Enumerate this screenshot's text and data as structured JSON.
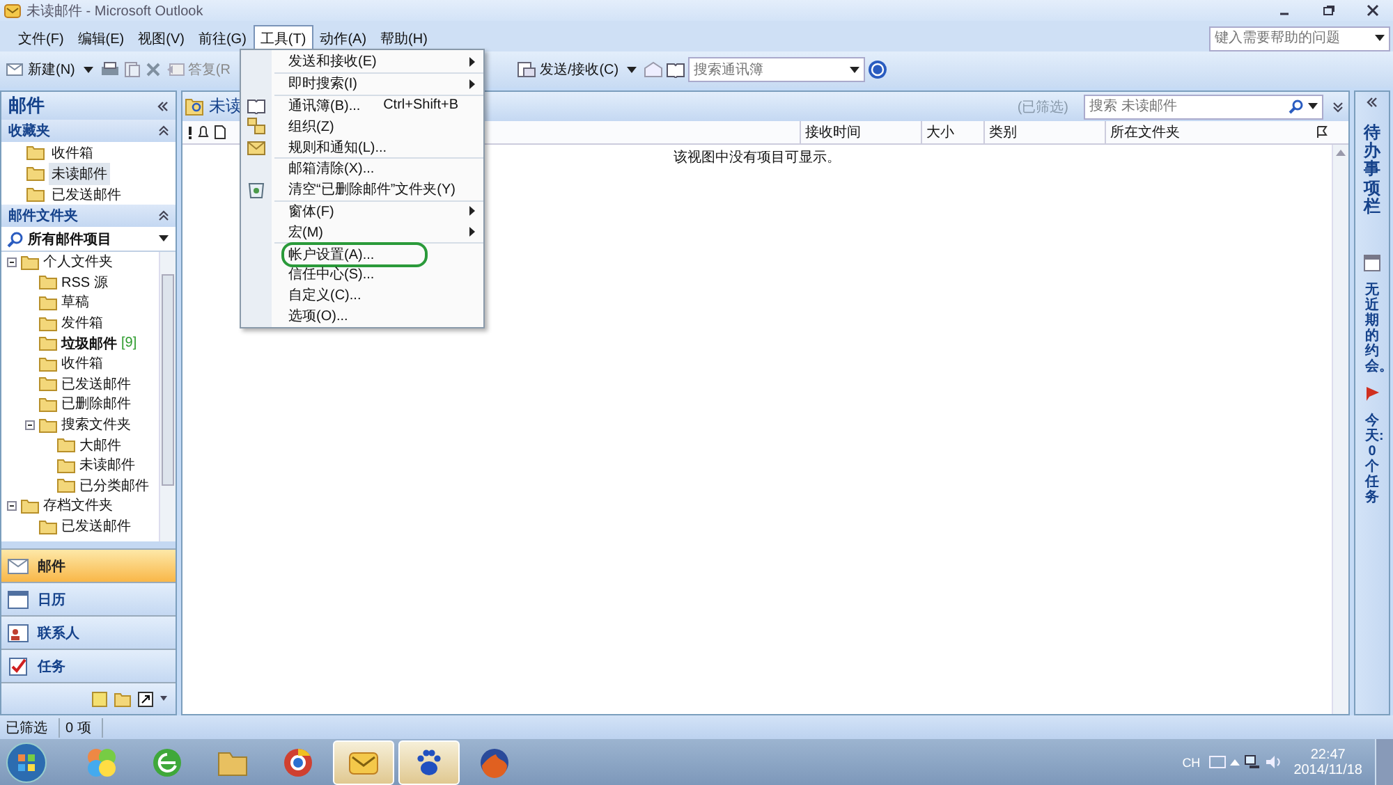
{
  "window": {
    "title": "未读邮件 - Microsoft Outlook"
  },
  "menubar": [
    {
      "label": "文件(F)",
      "selected": false
    },
    {
      "label": "编辑(E)",
      "selected": false
    },
    {
      "label": "视图(V)",
      "selected": false
    },
    {
      "label": "前往(G)",
      "selected": false
    },
    {
      "label": "工具(T)",
      "selected": true
    },
    {
      "label": "动作(A)",
      "selected": false
    },
    {
      "label": "帮助(H)",
      "selected": false
    }
  ],
  "help_search": {
    "placeholder": "键入需要帮助的问题"
  },
  "toolbar": {
    "new_button": "新建(N)",
    "reply_button": "答复(R",
    "send_receive_button": "发送/接收(C)",
    "address_search": {
      "placeholder": "搜索通讯簿"
    }
  },
  "tools_menu": {
    "groups": [
      [
        {
          "label": "发送和接收(E)",
          "kind": "none",
          "submenu": true,
          "highlighted": false
        }
      ],
      [
        {
          "label": "即时搜索(I)",
          "kind": "none",
          "submenu": true,
          "highlighted": false
        }
      ],
      [
        {
          "label": "通讯簿(B)...",
          "kind": "book",
          "shortcut": "Ctrl+Shift+B",
          "submenu": false,
          "highlighted": false
        },
        {
          "label": "组织(Z)",
          "kind": "organize",
          "submenu": false,
          "highlighted": false
        },
        {
          "label": "规则和通知(L)...",
          "kind": "rules",
          "submenu": false,
          "highlighted": false
        }
      ],
      [
        {
          "label": "邮箱清除(X)...",
          "kind": "none",
          "submenu": false,
          "highlighted": false
        },
        {
          "label": "清空“已删除邮件”文件夹(Y)",
          "kind": "recycle",
          "submenu": false,
          "highlighted": false
        }
      ],
      [
        {
          "label": "窗体(F)",
          "kind": "none",
          "submenu": true,
          "highlighted": false
        },
        {
          "label": "宏(M)",
          "kind": "none",
          "submenu": true,
          "highlighted": false
        }
      ],
      [
        {
          "label": "帐户设置(A)...",
          "kind": "none",
          "submenu": false,
          "highlighted": true
        },
        {
          "label": "信任中心(S)...",
          "kind": "none",
          "submenu": false,
          "highlighted": false
        },
        {
          "label": "自定义(C)...",
          "kind": "none",
          "submenu": false,
          "highlighted": false
        },
        {
          "label": "选项(O)...",
          "kind": "none",
          "submenu": false,
          "highlighted": false
        }
      ]
    ]
  },
  "navigation": {
    "title": "邮件",
    "favorites": {
      "title": "收藏夹",
      "items": [
        {
          "label": "收件箱",
          "selected": false
        },
        {
          "label": "未读邮件",
          "selected": true
        },
        {
          "label": "已发送邮件",
          "selected": false
        }
      ]
    },
    "mail_folders": {
      "title": "邮件文件夹",
      "view_selector": "所有邮件项目",
      "tree": [
        {
          "label": "个人文件夹",
          "expanded": true,
          "children": [
            {
              "label": "RSS 源"
            },
            {
              "label": "草稿"
            },
            {
              "label": "发件箱"
            },
            {
              "label": "垃圾邮件",
              "count": "[9]"
            },
            {
              "label": "收件箱"
            },
            {
              "label": "已发送邮件"
            },
            {
              "label": "已删除邮件"
            },
            {
              "label": "搜索文件夹",
              "expanded": true,
              "children": [
                {
                  "label": "大邮件"
                },
                {
                  "label": "未读邮件"
                },
                {
                  "label": "已分类邮件"
                }
              ]
            }
          ]
        },
        {
          "label": "存档文件夹",
          "expanded": true,
          "children": [
            {
              "label": "已发送邮件"
            }
          ]
        }
      ]
    },
    "buttons": [
      {
        "label": "邮件",
        "kind": "mail",
        "selected": true
      },
      {
        "label": "日历",
        "kind": "calendar",
        "selected": false
      },
      {
        "label": "联系人",
        "kind": "contacts",
        "selected": false
      },
      {
        "label": "任务",
        "kind": "tasks",
        "selected": false
      }
    ]
  },
  "content": {
    "title": "未读",
    "filter_note": "(已筛选)",
    "search": {
      "placeholder": "搜索 未读邮件"
    },
    "columns": [
      "接收时间",
      "大小",
      "类别",
      "所在文件夹"
    ],
    "empty_message": "该视图中没有项目可显示。"
  },
  "todo_bar": {
    "title": "待办事项栏",
    "appointments": "无近期的约会。",
    "tasks": "今天: 0 个任务"
  },
  "status_bar": [
    "已筛选",
    "0 项"
  ],
  "taskbar": {
    "apps": [
      {
        "kind": "squares",
        "active": false
      },
      {
        "kind": "browser",
        "active": false
      },
      {
        "kind": "folder",
        "active": false
      },
      {
        "kind": "ring",
        "active": false
      },
      {
        "kind": "mail",
        "active": true
      },
      {
        "kind": "paw",
        "active": true
      },
      {
        "kind": "fox",
        "active": false
      }
    ],
    "language": "CH",
    "time": "22:47",
    "date": "2014/11/18"
  }
}
